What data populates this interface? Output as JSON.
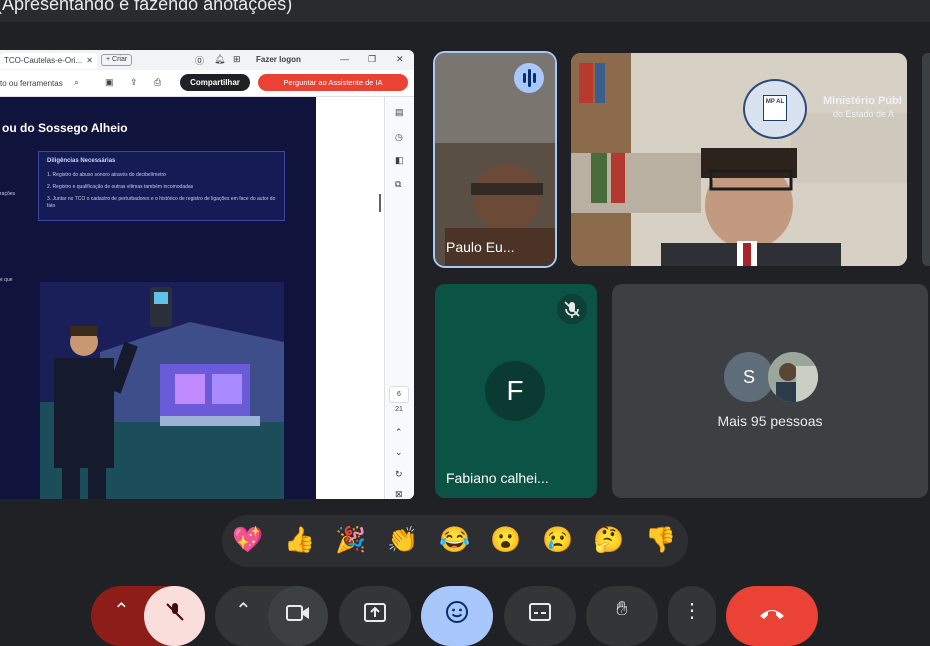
{
  "header": {
    "title": "(Apresentando e fazendo anotações)"
  },
  "browser": {
    "tab_title": "TCO-Cautelas-e-Ori...",
    "tab_close": "✕",
    "new_tab": "+ Criar",
    "login": "Fazer logon",
    "toolbar_text": "to ou ferramentas",
    "share_button": "Compartilhar",
    "ask_button": "Perguntar ao Assistente de IA"
  },
  "document": {
    "title": "ou do Sossego Alheio",
    "side_words": [
      "rações",
      "e que"
    ],
    "box_heading": "Diligências Necessárias",
    "box_items": [
      "1.   Registro do abuso sonoro através do decibelímetro",
      "2.   Registro e qualificação de outras vítimas também incomodadas",
      "3.   Juntar no TCO o cadastro de perturbadores e o histórico de registro de ligações em face do autor do fato"
    ],
    "page_current": "6",
    "page_total": "21"
  },
  "participants": {
    "paulo": {
      "name": "Paulo Eu..."
    },
    "ministerio": {
      "logo_text": "Ministério Públ",
      "logo_sub": "do Estado de A",
      "badge": "MP AL"
    },
    "fabiano": {
      "name": "Fabiano calhei...",
      "initial": "F"
    },
    "others": {
      "label": "Mais 95 pessoas",
      "initial": "S"
    }
  },
  "reactions": [
    "💖",
    "👍",
    "🎉",
    "👏",
    "😂",
    "😮",
    "😢",
    "🤔",
    "👎"
  ],
  "icons": {
    "mic_off": "mic-off-icon",
    "speaking": "speaking-icon"
  },
  "colors": {
    "background": "#202124",
    "tile": "#3c4043",
    "fabiano_tile": "#0b5345",
    "end_call": "#ea4335",
    "active_control": "#a8c7fa"
  }
}
